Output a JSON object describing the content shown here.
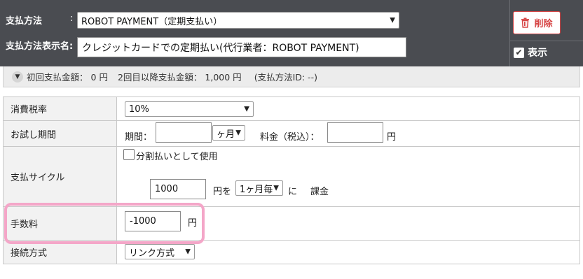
{
  "header": {
    "payment_method_label": "支払方法",
    "payment_method_display_label": "支払方法表示名:",
    "colon": ":",
    "payment_method_value": "ROBOT PAYMENT（定期支払い）",
    "display_name_value": "クレジットカードでの定期払い(代行業者：ROBOT PAYMENT)",
    "delete_label": "削除",
    "display_label": "表示"
  },
  "summary": {
    "first_amount_label": "初回支払金額：",
    "first_amount_value": "0 円",
    "subsequent_label": "2回目以降支払金額：",
    "subsequent_value": "1,000 円",
    "method_id": "(支払方法ID: --)"
  },
  "rows": {
    "tax": {
      "label": "消費税率",
      "value": "10%"
    },
    "trial": {
      "label": "お試し期間",
      "period_label": "期間：",
      "period_value": "",
      "unit_value": "ヶ月",
      "fee_label": "料金（税込）：",
      "fee_value": "",
      "yen": "円"
    },
    "cycle": {
      "label": "支払サイクル",
      "installment_label": "分割払いとして使用",
      "amount_value": "1000",
      "amount_suffix": "円を",
      "interval_value": "1ヶ月毎",
      "ni": "に",
      "charge_label": "課金"
    },
    "fee": {
      "label": "手数料",
      "value": "-1000",
      "yen": "円"
    },
    "connection": {
      "label": "接続方式",
      "value": "リンク方式"
    }
  },
  "colors": {
    "header_bg": "#4a4c51",
    "danger": "#d64545",
    "highlight": "#f4a6c8"
  }
}
